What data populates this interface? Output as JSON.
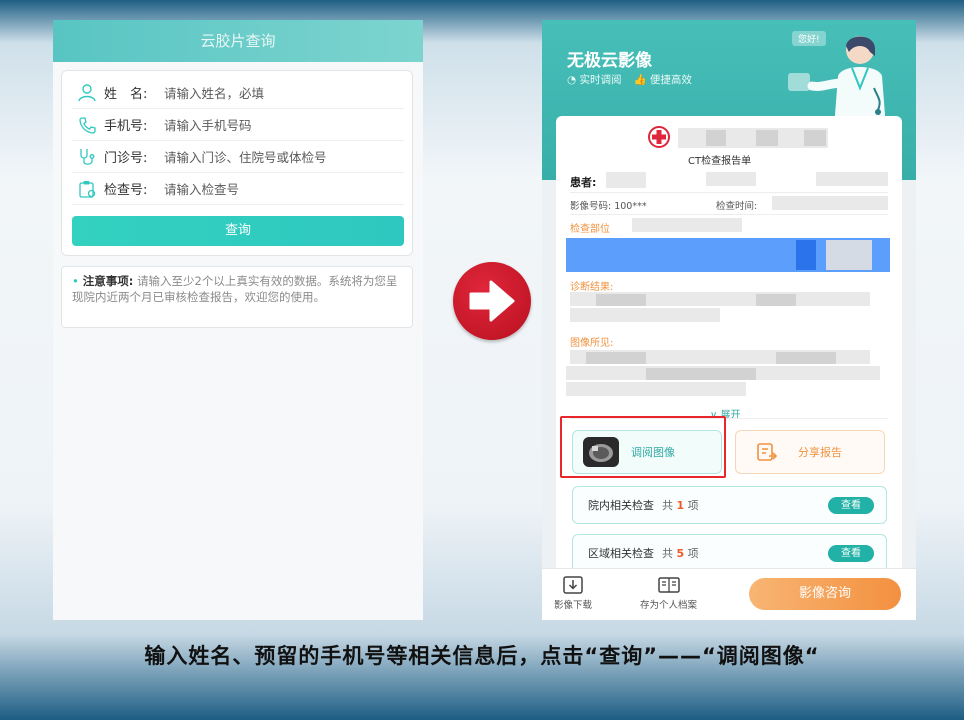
{
  "left": {
    "header_title": "云胶片查询",
    "fields": [
      {
        "label": "姓　名:",
        "placeholder": "请输入姓名，必填"
      },
      {
        "label": "手机号:",
        "placeholder": "请输入手机号码"
      },
      {
        "label": "门诊号:",
        "placeholder": "请输入门诊、住院号或体检号"
      },
      {
        "label": "检查号:",
        "placeholder": "请输入检查号"
      }
    ],
    "query_button": "查询",
    "notice_title": "注意事项:",
    "notice_body": "请输入至少2个以上真实有效的数据。系统将为您呈现院内近两个月已审核检查报告，欢迎您的使用。"
  },
  "right": {
    "app_title": "无极云影像",
    "tags": [
      "实时调阅",
      "便捷高效"
    ],
    "hello_badge": "您好!",
    "report_title": "CT检查报告单",
    "patient_label": "患者:",
    "image_no": "影像号码: 100***",
    "exam_time_label": "检查时间:",
    "exam_site_label": "检查部位",
    "diagnosis_label": "诊断结果:",
    "findings_label": "图像所见:",
    "expand_label": "展开",
    "view_image_button": "调阅图像",
    "share_report_button": "分享报告",
    "related": [
      {
        "name": "院内相关检查",
        "count_prefix": "共",
        "count": "1",
        "count_suffix": "项",
        "action": "查看"
      },
      {
        "name": "区域相关检查",
        "count_prefix": "共",
        "count": "5",
        "count_suffix": "项",
        "action": "查看"
      }
    ],
    "bottom": {
      "download": "影像下载",
      "save": "存为个人档案",
      "consult": "影像咨询"
    }
  },
  "caption": "输入姓名、预留的手机号等相关信息后，点击“查询”——“调阅图像“",
  "colors": {
    "teal": "#2fc8c0",
    "orange": "#f3903f",
    "red": "#e8262b"
  }
}
